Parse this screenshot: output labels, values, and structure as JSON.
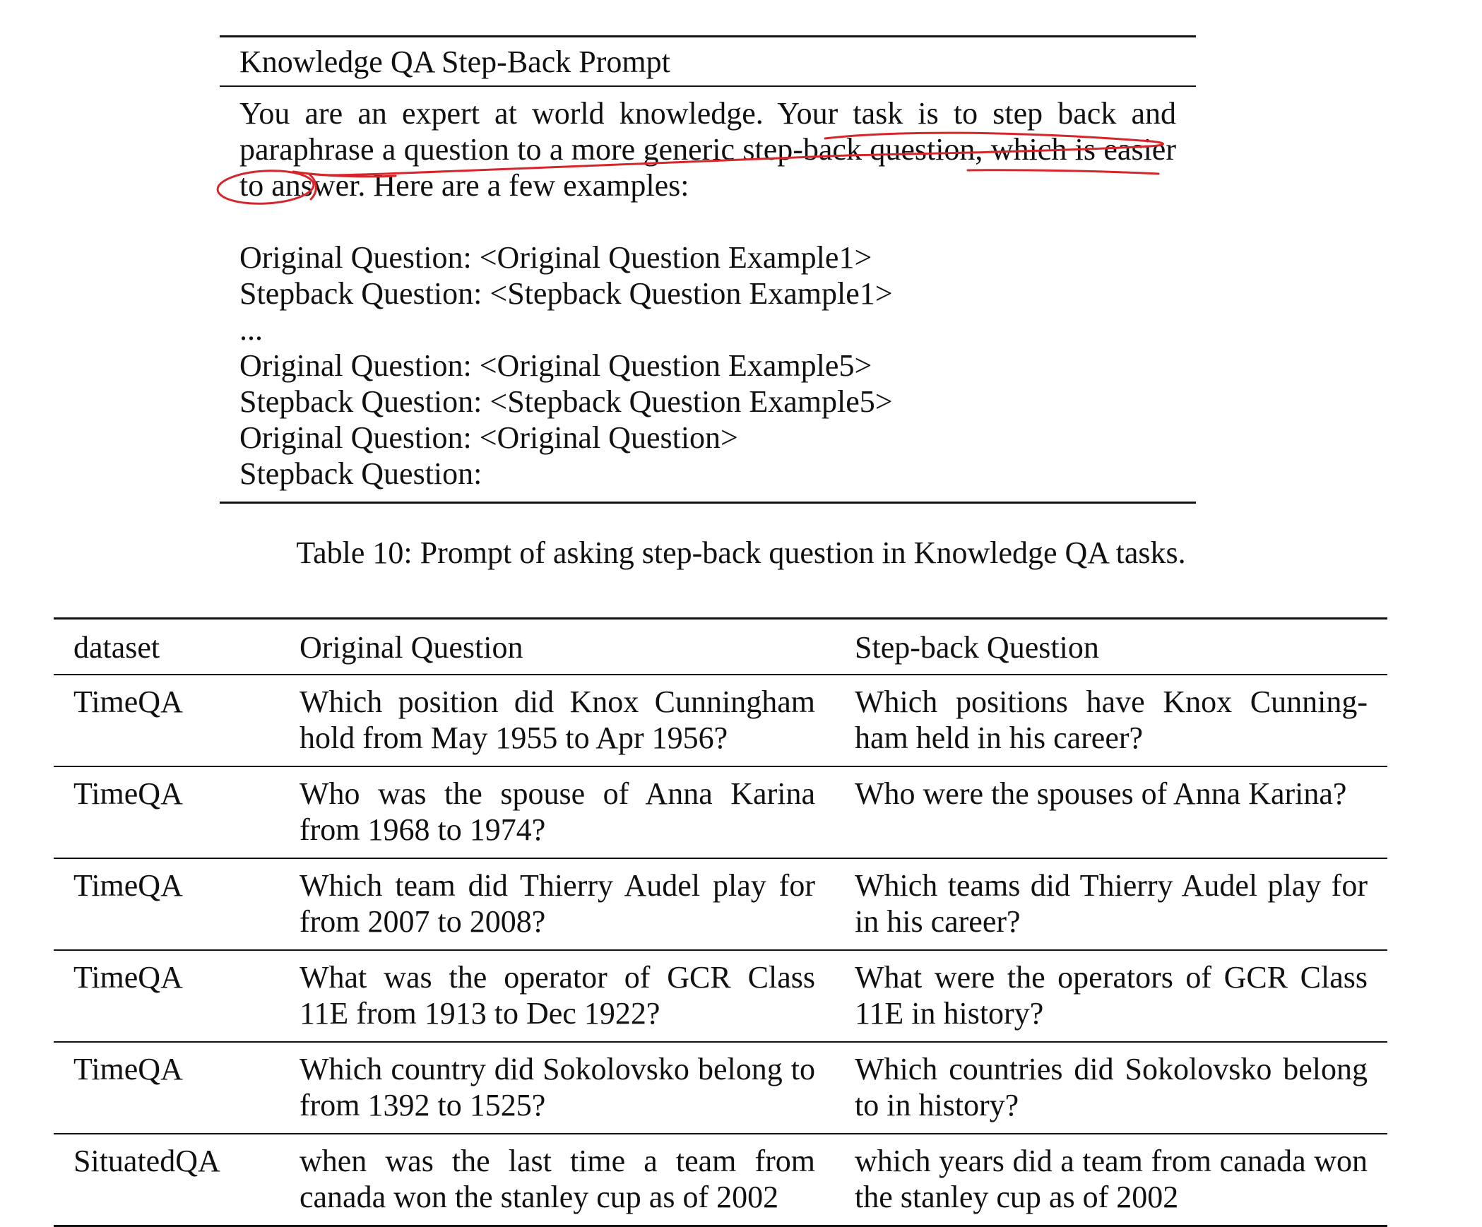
{
  "prompt": {
    "title": "Knowledge QA Step-Back Prompt",
    "intro": "You are an expert at world knowledge. Your task is to step back and paraphrase a question to a more generic step-back question, which is easier to answer. Here are a few examples:",
    "lines": [
      "Original Question: <Original Question Example1>",
      "Stepback Question: <Stepback Question Example1>",
      "...",
      "Original Question: <Original Question Example5>",
      "Stepback Question: <Stepback Question Example5>",
      "Original Question: <Original Question>",
      "Stepback Question:"
    ]
  },
  "caption": "Table 10: Prompt of asking step-back question in Knowledge QA tasks.",
  "table": {
    "headers": [
      "dataset",
      "Original Question",
      "Step-back Question"
    ],
    "rows": [
      [
        "TimeQA",
        "Which position did Knox Cunningham hold from May 1955 to Apr 1956?",
        "Which positions have Knox Cunning­ham held in his career?"
      ],
      [
        "TimeQA",
        "Who was the spouse of Anna Karina from 1968 to 1974?",
        "Who were the spouses of Anna Karina?"
      ],
      [
        "TimeQA",
        "Which team did Thierry Audel play for from 2007 to 2008?",
        "Which teams did Thierry Audel play for in his career?"
      ],
      [
        "TimeQA",
        "What was the operator of GCR Class 11E from 1913 to Dec 1922?",
        "What were the operators of GCR Class 11E in history?"
      ],
      [
        "TimeQA",
        "Which country did Sokolovsko belong to from 1392 to 1525?",
        "Which countries did Sokolovsko belong to in history?"
      ],
      [
        "SituatedQA",
        "when was the last time a team from canada won the stanley cup as of 2002",
        "which years did a team from canada won the stanley cup as of 2002"
      ]
    ]
  },
  "annotation_color": "#d7262b"
}
